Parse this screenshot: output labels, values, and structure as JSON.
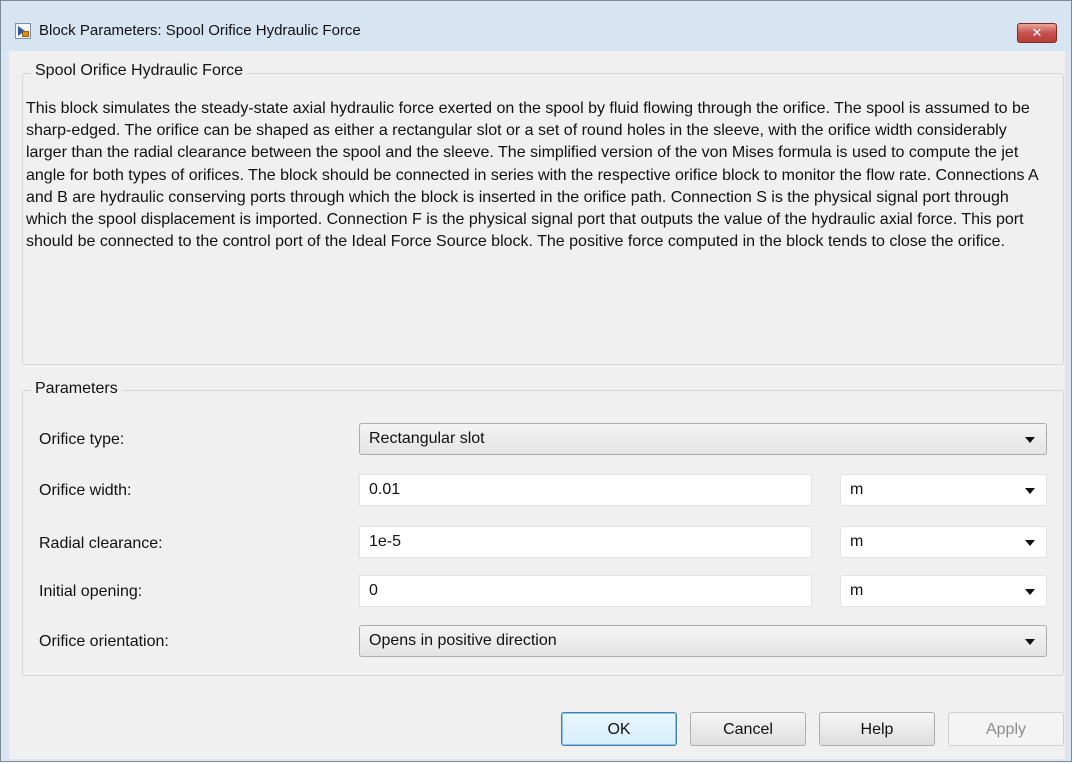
{
  "window": {
    "title": "Block Parameters: Spool Orifice Hydraulic Force",
    "close_label": "✕"
  },
  "description": {
    "group_title": "Spool Orifice Hydraulic Force",
    "text": "This block simulates the steady-state axial hydraulic force exerted on the spool by fluid flowing through the orifice. The spool is assumed to be sharp-edged. The orifice can be shaped as either a rectangular slot or a set of round holes in the sleeve, with the orifice width considerably larger than the radial clearance between the spool and the sleeve. The simplified version of the von Mises formula is used to compute the jet angle for both types of orifices. The block should be connected in series with the respective orifice block to monitor the flow rate. Connections A and B are hydraulic conserving ports through which the block is inserted in the orifice path. Connection S is the physical signal port through which the spool displacement is imported. Connection F is the physical signal port that outputs the value of the hydraulic axial force. This port should be connected to the control port of the Ideal Force Source block. The positive force computed in the block tends to close the orifice."
  },
  "parameters": {
    "group_title": "Parameters",
    "orifice_type": {
      "label": "Orifice type:",
      "value": "Rectangular slot"
    },
    "orifice_width": {
      "label": "Orifice width:",
      "value": "0.01",
      "unit": "m"
    },
    "radial_clearance": {
      "label": "Radial clearance:",
      "value": "1e-5",
      "unit": "m"
    },
    "initial_opening": {
      "label": "Initial opening:",
      "value": "0",
      "unit": "m"
    },
    "orifice_orientation": {
      "label": "Orifice orientation:",
      "value": "Opens in positive direction"
    }
  },
  "buttons": {
    "ok": "OK",
    "cancel": "Cancel",
    "help": "Help",
    "apply": "Apply"
  },
  "colors": {
    "titlebar": "#d7e4f2",
    "client": "#f0f0f0",
    "close_button": "#c75050",
    "default_button_border": "#3c7fb1"
  },
  "icons": {
    "app": "simulink-block-icon",
    "close": "close-icon",
    "dropdown": "chevron-down-icon"
  }
}
